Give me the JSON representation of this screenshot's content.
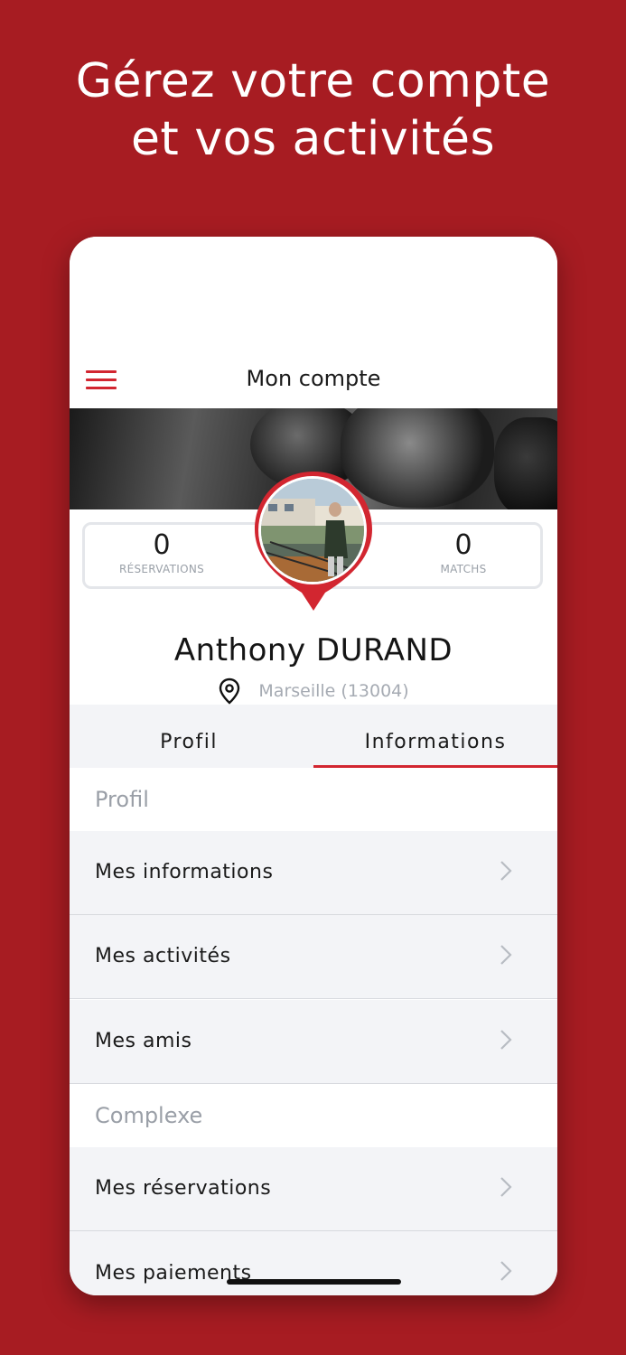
{
  "headline": {
    "line1": "Gérez votre compte",
    "line2": "et vos activités"
  },
  "header": {
    "title": "Mon compte",
    "menu_icon": "hamburger-menu-icon"
  },
  "stats": {
    "reservations": {
      "value": "0",
      "label": "RÉSERVATIONS"
    },
    "matchs": {
      "value": "0",
      "label": "MATCHS"
    }
  },
  "profile": {
    "name": "Anthony  DURAND",
    "location": "Marseille (13004)"
  },
  "tabs": [
    {
      "label": "Profil",
      "active": false
    },
    {
      "label": "Informations",
      "active": true
    }
  ],
  "sections": [
    {
      "title": "Profil",
      "items": [
        {
          "label": "Mes informations"
        },
        {
          "label": "Mes activités"
        },
        {
          "label": "Mes amis"
        }
      ]
    },
    {
      "title": "Complexe",
      "items": [
        {
          "label": "Mes réservations"
        },
        {
          "label": "Mes paiements"
        }
      ]
    }
  ],
  "colors": {
    "brand_red": "#d22630",
    "background_red": "#a71c22",
    "row_background": "#f3f4f7",
    "muted_text": "#9a9fa7"
  }
}
